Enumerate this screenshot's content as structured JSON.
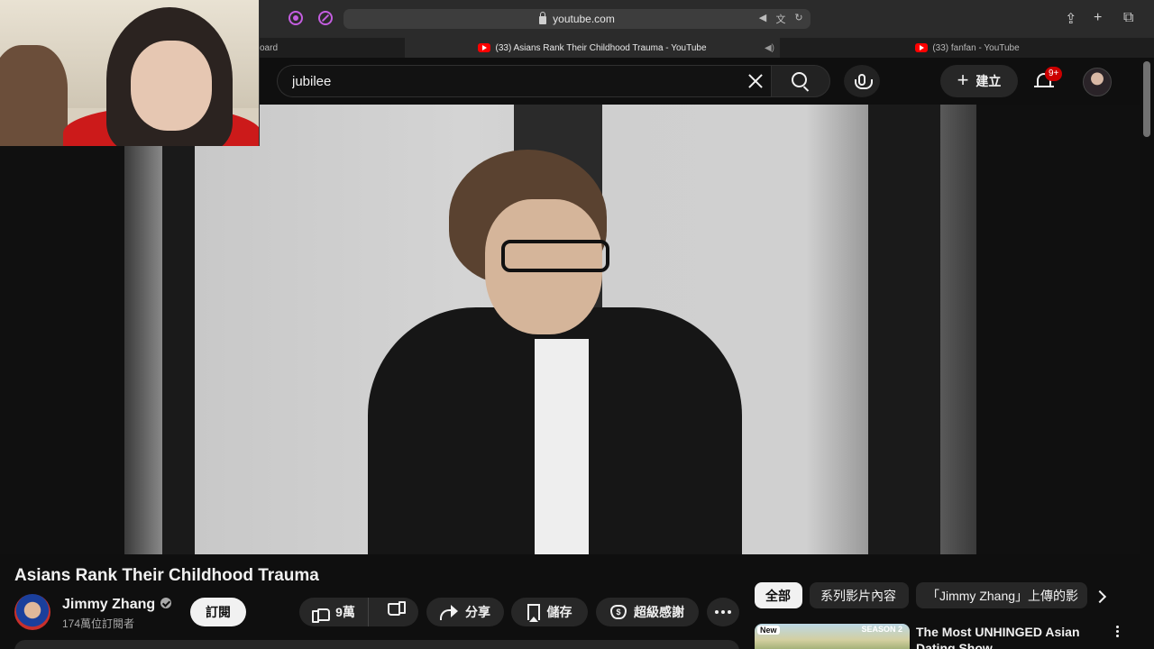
{
  "browser": {
    "url": "youtube.com",
    "tabs": [
      {
        "label": "oard"
      },
      {
        "label": "(33) Asians Rank Their Childhood Trauma - YouTube"
      },
      {
        "label": "(33) fanfan - YouTube"
      }
    ]
  },
  "header": {
    "search_value": "jubilee",
    "create_label": "建立",
    "notification_badge": "9+"
  },
  "video": {
    "title": "Asians Rank Their Childhood Trauma",
    "channel_name": "Jimmy Zhang",
    "subscribers": "174萬位訂閱者",
    "subscribe_label": "訂閱",
    "like_count": "9萬",
    "share_label": "分享",
    "save_label": "儲存",
    "thanks_label": "超級感謝"
  },
  "chips": [
    {
      "label": "全部"
    },
    {
      "label": "系列影片內容"
    },
    {
      "label": "「Jimmy Zhang」上傳的影"
    }
  ],
  "recommendation": {
    "badge": "New",
    "thumb_text": "SEASON 2",
    "title": "The Most UNHINGED Asian Dating Show"
  },
  "colors": {
    "accent_red": "#ff0000",
    "extension_purple": "#c45ee0",
    "background": "#0f0f0f"
  },
  "icons": [
    "lock-icon",
    "search-icon",
    "mic-icon",
    "plus-icon",
    "bell-icon",
    "verified-icon",
    "like-icon",
    "dislike-icon",
    "share-icon",
    "bookmark-icon",
    "super-thanks-icon",
    "more-icon",
    "chevron-right-icon"
  ]
}
